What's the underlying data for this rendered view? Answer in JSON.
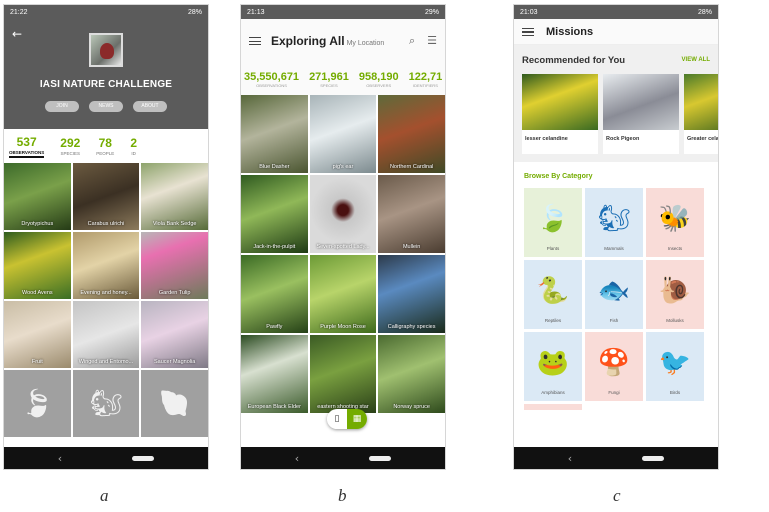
{
  "captions": {
    "a": "a",
    "b": "b",
    "c": "c"
  },
  "colors": {
    "accent": "#74ac00",
    "navbar": "#111111",
    "header": "#5b5b5b"
  },
  "phone_a": {
    "status_time": "21:22",
    "status_battery": "28%",
    "project_title": "IASI NATURE CHALLENGE",
    "buttons": [
      "JOIN",
      "NEWS",
      "ABOUT"
    ],
    "stats": [
      {
        "num": "537",
        "label": "OBSERVATIONS"
      },
      {
        "num": "292",
        "label": "SPECIES"
      },
      {
        "num": "78",
        "label": "PEOPLE"
      },
      {
        "num": "2",
        "label": "ID"
      }
    ],
    "tiles": [
      {
        "label": "Dryotypichus",
        "bg": "linear-gradient(160deg,#3c6a2a,#7aa04a 45%,#253b16)"
      },
      {
        "label": "Carabus ulrichi",
        "bg": "linear-gradient(160deg,#6b5a40,#3b3023 50%,#8c7a5c)"
      },
      {
        "label": "Viola Bank Sedge",
        "bg": "linear-gradient(160deg,#8da36b,#e8e2d2 40%,#566b38)"
      },
      {
        "label": "Wood Avens",
        "bg": "linear-gradient(160deg,#2e5c1e,#c9c231 40%,#3a6e24)"
      },
      {
        "label": "Evening and honey...",
        "bg": "linear-gradient(160deg,#b09a6b,#e3d3a7 45%,#6a5a3a)"
      },
      {
        "label": "Garden Tulip",
        "bg": "linear-gradient(160deg,#b7b7b7,#e870b0 30%,#6d7a5a)"
      },
      {
        "label": "Fruit",
        "bg": "linear-gradient(160deg,#c9bda5,#e8dccb 45%,#9a8a6c)"
      },
      {
        "label": "Winged and Entomo...",
        "bg": "linear-gradient(160deg,#c4c4c4,#e6e6e6 50%,#9a9a9a)"
      },
      {
        "label": "Saucer Magnolia",
        "bg": "linear-gradient(160deg,#b8b4c0,#e8d2e4 45%,#7f7a86)"
      }
    ],
    "icon_tiles": [
      "leaf-icon",
      "squirrel-icon",
      "shell-icon"
    ]
  },
  "phone_b": {
    "status_time": "21:13",
    "status_battery": "29%",
    "title": "Exploring All",
    "location": "My Location",
    "stats": [
      {
        "num": "35,550,671",
        "label": "OBSERVATIONS"
      },
      {
        "num": "271,961",
        "label": "SPECIES"
      },
      {
        "num": "958,190",
        "label": "OBSERVERS"
      },
      {
        "num": "122,71",
        "label": "IDENTIFIERS"
      }
    ],
    "tiles": [
      {
        "label": "Blue Dasher",
        "bg": "linear-gradient(160deg,#57673a,#b3b49c 45%,#4a5530)"
      },
      {
        "label": "pig's ear",
        "bg": "linear-gradient(160deg,#a8b4b8,#e6ecee 45%,#7c8a8e)"
      },
      {
        "label": "Northern Cardinal",
        "bg": "linear-gradient(160deg,#5e6a3a,#a4502e 45%,#3f4a26)"
      },
      {
        "label": "Jack-in-the-pulpit",
        "bg": "linear-gradient(160deg,#2f5a20,#90b858 45%,#1e3a14)"
      },
      {
        "label": "Seven-spotted Lady...",
        "bg": "radial-gradient(circle at 50% 45%,#4a1010 10%,#c8c8c8 22%,#dadada 60%)"
      },
      {
        "label": "Mullein",
        "bg": "linear-gradient(160deg,#6a5a4a,#a89484 45%,#4a3c30)"
      },
      {
        "label": "Pawfly",
        "bg": "linear-gradient(160deg,#3a6a24,#9ac060 45%,#244016)"
      },
      {
        "label": "Purple Moon Rose",
        "bg": "linear-gradient(160deg,#6c9a36,#b8d46a 45%,#3e6a1c)"
      },
      {
        "label": "Calligraphy species",
        "bg": "linear-gradient(160deg,#2c3a4a,#5a8ac0 40%,#1a2a1a)"
      },
      {
        "label": "European Black Elder",
        "bg": "linear-gradient(160deg,#2a4a20,#d8e0d0 40%,#3a5a2a)"
      },
      {
        "label": "eastern shooting star",
        "bg": "linear-gradient(160deg,#3a5a24,#7aa040 45%,#2a4018)"
      },
      {
        "label": "Norway spruce",
        "bg": "linear-gradient(160deg,#4a6a30,#a0c070 45%,#2e4a1c)"
      }
    ]
  },
  "phone_c": {
    "status_time": "21:03",
    "status_battery": "28%",
    "title": "Missions",
    "recommended_title": "Recommended for You",
    "view_all": "VIEW ALL",
    "cards": [
      {
        "label": "lesser celandine",
        "bg": "linear-gradient(160deg,#2f5a1e,#e0d030 40%,#3a6a22)"
      },
      {
        "label": "Rock Pigeon",
        "bg": "linear-gradient(160deg,#e8ecef,#8a8c96 55%,#c8ccd0)"
      },
      {
        "label": "Greater celandine",
        "bg": "linear-gradient(160deg,#4a7a2a,#d8c830 40%,#2e5a1c)"
      }
    ],
    "browse_title": "Browse By Category",
    "categories": [
      {
        "label": "Plants",
        "icon": "leaf-icon",
        "glyph": "🍃",
        "tone": "plant",
        "color": "#74ac00"
      },
      {
        "label": "Mammals",
        "icon": "squirrel-icon",
        "glyph": "🐿",
        "tone": "blue",
        "color": "#1c6fb5"
      },
      {
        "label": "Insects",
        "icon": "insect-icon",
        "glyph": "🐝",
        "tone": "red",
        "color": "#e8502a"
      },
      {
        "label": "Reptiles",
        "icon": "snake-icon",
        "glyph": "🐍",
        "tone": "blue",
        "color": "#1c6fb5"
      },
      {
        "label": "Fish",
        "icon": "fish-icon",
        "glyph": "🐟",
        "tone": "blue",
        "color": "#1c6fb5"
      },
      {
        "label": "Mollusks",
        "icon": "snail-icon",
        "glyph": "🐌",
        "tone": "red",
        "color": "#e8502a"
      },
      {
        "label": "Amphibians",
        "icon": "frog-icon",
        "glyph": "🐸",
        "tone": "blue",
        "color": "#1c6fb5"
      },
      {
        "label": "Fungi",
        "icon": "mushroom-icon",
        "glyph": "🍄",
        "tone": "red",
        "color": "#c41e6a"
      },
      {
        "label": "Birds",
        "icon": "bird-icon",
        "glyph": "🐦",
        "tone": "blue",
        "color": "#1c6fb5"
      }
    ]
  }
}
